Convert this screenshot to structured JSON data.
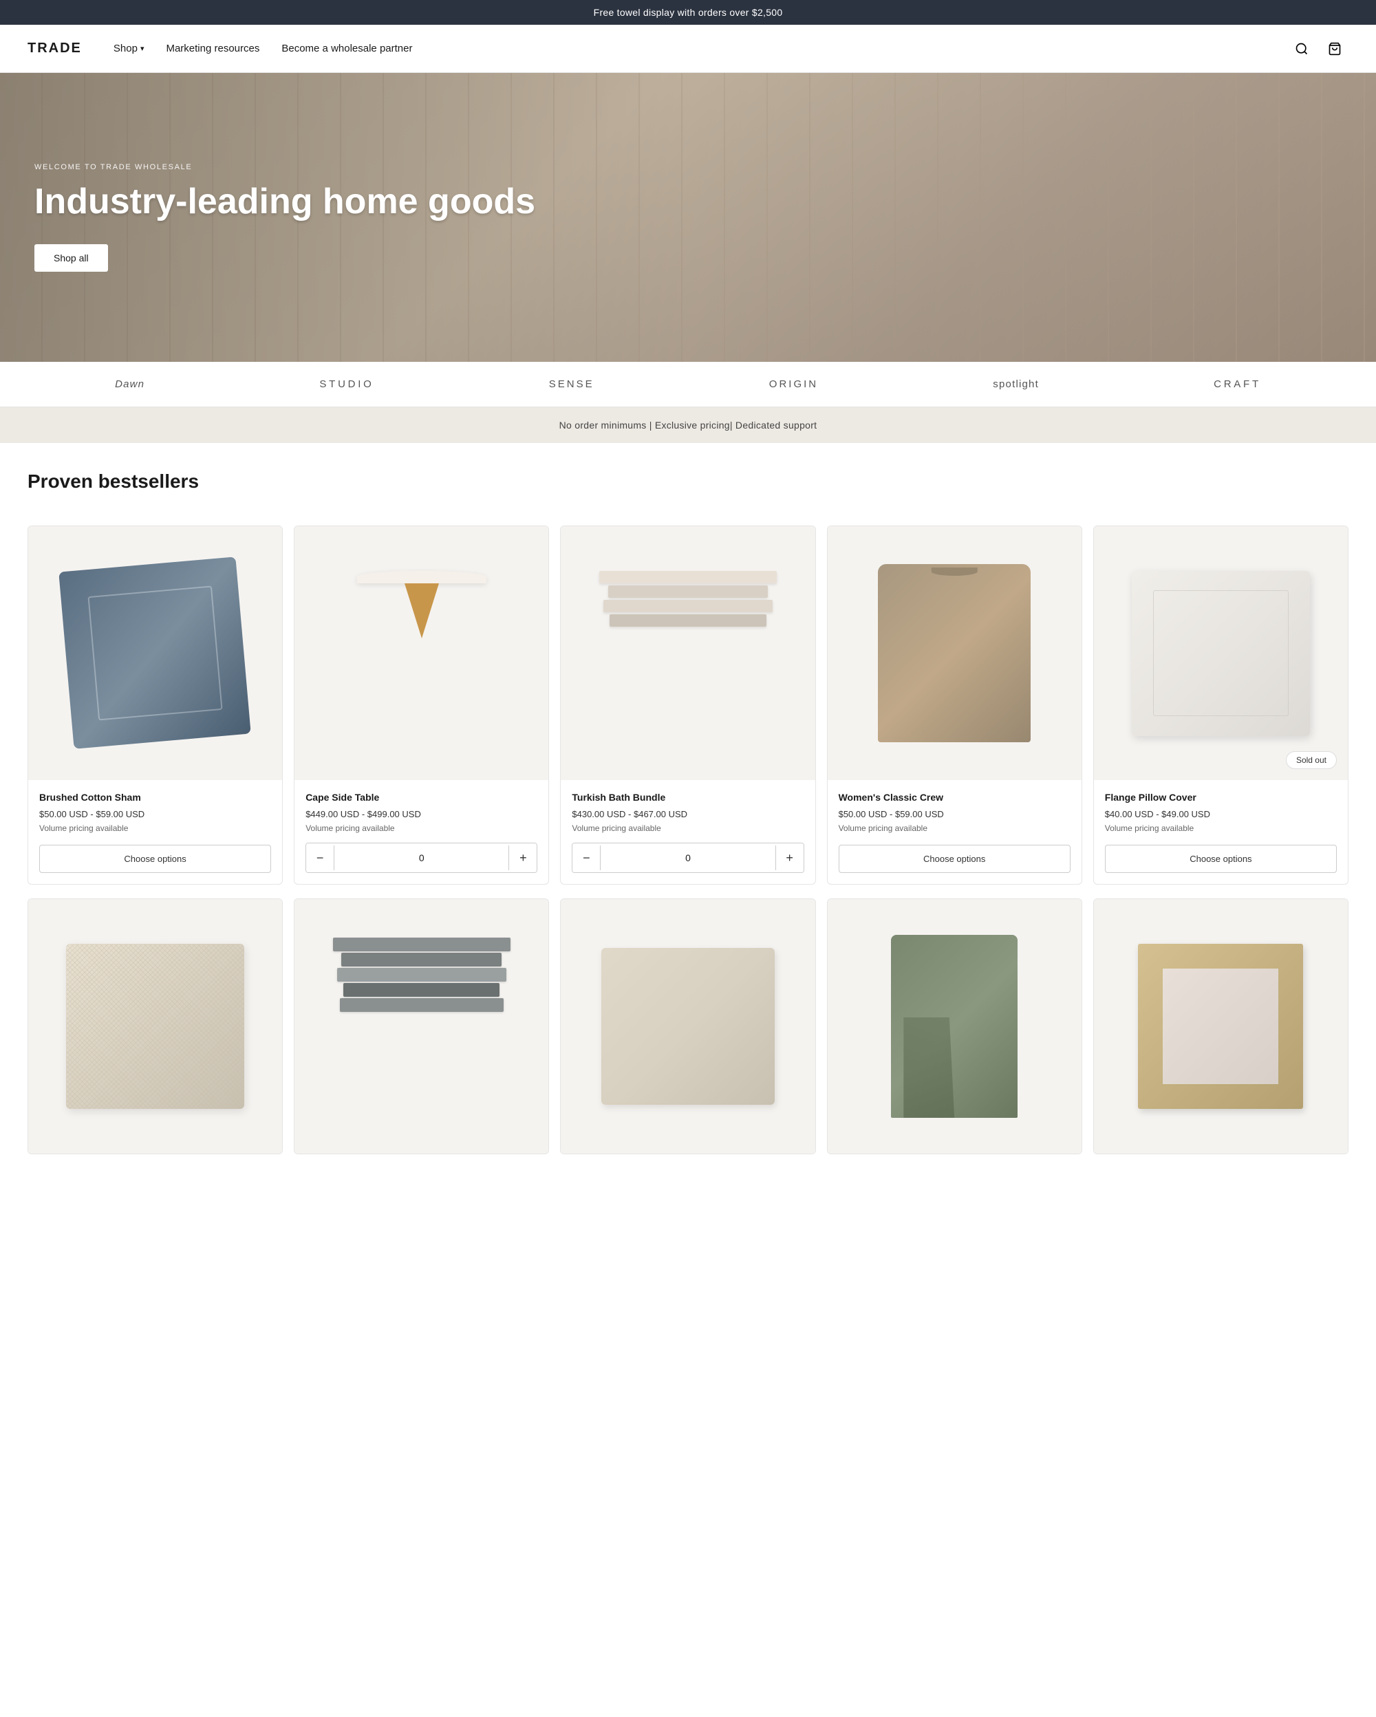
{
  "announcement": {
    "text": "Free towel display with orders over $2,500"
  },
  "header": {
    "logo": "TRADE",
    "nav": [
      {
        "label": "Shop",
        "hasDropdown": true
      },
      {
        "label": "Marketing resources"
      },
      {
        "label": "Become a wholesale partner"
      }
    ],
    "actions": {
      "search_label": "Search",
      "cart_label": "Cart"
    }
  },
  "hero": {
    "subtitle": "WELCOME TO TRADE WHOLESALE",
    "title": "Industry-leading home goods",
    "cta": "Shop all"
  },
  "brand_logos": [
    {
      "label": "Dawn",
      "style": "italic"
    },
    {
      "label": "STUDIO",
      "style": "wide"
    },
    {
      "label": "SENSE",
      "style": "caps"
    },
    {
      "label": "ORIGIN",
      "style": "caps"
    },
    {
      "label": "spotlight",
      "style": "normal"
    },
    {
      "label": "CRAFT",
      "style": "wide"
    }
  ],
  "benefits_bar": {
    "text": "No order minimums | Exclusive pricing| Dedicated support"
  },
  "bestsellers": {
    "title": "Proven bestsellers",
    "products": [
      {
        "id": "brushed-cotton-sham",
        "name": "Brushed Cotton Sham",
        "price": "$50.00 USD - $59.00 USD",
        "volume": "Volume pricing available",
        "action": "choose_options",
        "sold_out": false,
        "qty": null
      },
      {
        "id": "cape-side-table",
        "name": "Cape Side Table",
        "price": "$449.00 USD - $499.00 USD",
        "volume": "Volume pricing available",
        "action": "qty_stepper",
        "sold_out": false,
        "qty": 0
      },
      {
        "id": "turkish-bath-bundle",
        "name": "Turkish Bath Bundle",
        "price": "$430.00 USD - $467.00 USD",
        "volume": "Volume pricing available",
        "action": "qty_stepper",
        "sold_out": false,
        "qty": 0
      },
      {
        "id": "womens-classic-crew",
        "name": "Women's Classic Crew",
        "price": "$50.00 USD - $59.00 USD",
        "volume": "Volume pricing available",
        "action": "choose_options",
        "sold_out": false,
        "qty": null
      },
      {
        "id": "flange-pillow-cover",
        "name": "Flange Pillow Cover",
        "price": "$40.00 USD - $49.00 USD",
        "volume": "Volume pricing available",
        "action": "choose_options",
        "sold_out": true,
        "qty": null
      }
    ],
    "choose_options_label": "Choose options",
    "sold_out_label": "Sold out",
    "qty_decrease_label": "−",
    "qty_increase_label": "+"
  }
}
